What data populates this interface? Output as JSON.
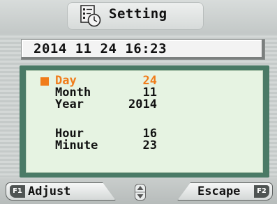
{
  "header": {
    "title": "Setting",
    "icon": "settings-clock-icon"
  },
  "datetime_display": "2014 11 24 16:23",
  "fields": [
    {
      "label": "Day",
      "value": "24",
      "selected": true
    },
    {
      "label": "Month",
      "value": "11",
      "selected": false
    },
    {
      "label": "Year",
      "value": "2014",
      "selected": false
    },
    {
      "label": "Hour",
      "value": "16",
      "selected": false
    },
    {
      "label": "Minute",
      "value": "23",
      "selected": false
    }
  ],
  "footer": {
    "left_key": "F1",
    "left_label": "Adjust",
    "right_key": "F2",
    "right_label": "Escape",
    "center_icon": "up-down-arrows-icon"
  },
  "colors": {
    "selected": "#f07c1a",
    "panel_border": "#4a7a66",
    "panel_fill": "#e6f3e2"
  }
}
